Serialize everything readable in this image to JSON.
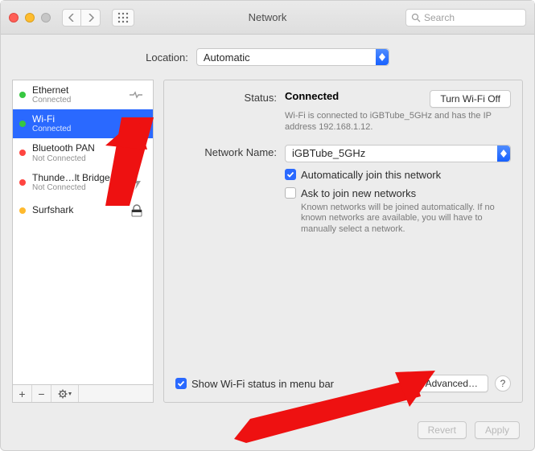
{
  "window": {
    "title": "Network"
  },
  "toolbar": {
    "search_placeholder": "Search"
  },
  "location": {
    "label": "Location:",
    "value": "Automatic"
  },
  "sidebar": {
    "items": [
      {
        "name": "Ethernet",
        "status": "Connected",
        "dot": "green",
        "icon": "ethernet"
      },
      {
        "name": "Wi-Fi",
        "status": "Connected",
        "dot": "green",
        "icon": "wifi",
        "selected": true
      },
      {
        "name": "Bluetooth PAN",
        "status": "Not Connected",
        "dot": "red",
        "icon": "bluetooth"
      },
      {
        "name": "Thunde…lt Bridge",
        "status": "Not Connected",
        "dot": "red",
        "icon": "thunderbolt"
      },
      {
        "name": "Surfshark",
        "status": "",
        "dot": "amber",
        "icon": "lock"
      }
    ]
  },
  "detail": {
    "status_label": "Status:",
    "status_value": "Connected",
    "turn_off_label": "Turn Wi-Fi Off",
    "status_sub": "Wi-Fi is connected to iGBTube_5GHz and has the IP address 192.168.1.12.",
    "network_label": "Network Name:",
    "network_value": "iGBTube_5GHz",
    "auto_join": "Automatically join this network",
    "ask_join": "Ask to join new networks",
    "ask_join_sub": "Known networks will be joined automatically. If no known networks are available, you will have to manually select a network.",
    "show_menubar": "Show Wi-Fi status in menu bar",
    "advanced_label": "Advanced…",
    "help_label": "?"
  },
  "footer": {
    "revert": "Revert",
    "apply": "Apply"
  }
}
